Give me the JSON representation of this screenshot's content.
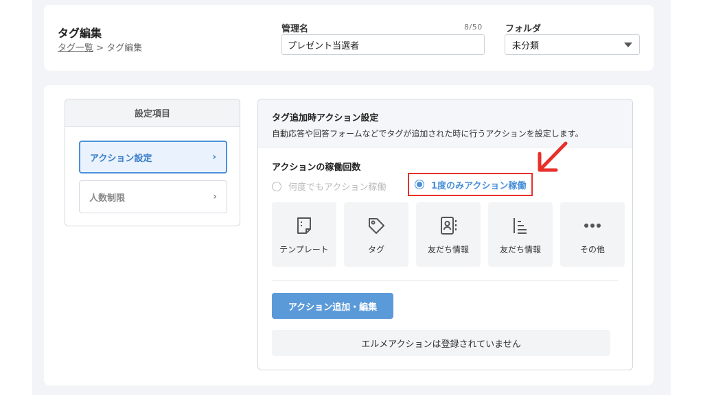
{
  "header": {
    "title": "タグ編集",
    "breadcrumb": {
      "link": "タグ一覧",
      "separator": " > ",
      "current": "タグ編集"
    },
    "name_field": {
      "label": "管理名",
      "counter": "8/50",
      "value": "プレゼント当選者"
    },
    "folder_field": {
      "label": "フォルダ",
      "value": "未分類"
    }
  },
  "side_menu": {
    "title": "設定項目",
    "items": [
      {
        "label": "アクション設定",
        "active": true
      },
      {
        "label": "人数制限",
        "active": false
      }
    ]
  },
  "settings": {
    "title": "タグ追加時アクション設定",
    "description": "自動応答や回答フォームなどでタグが追加された時に行うアクションを設定します。",
    "frequency_label": "アクションの稼働回数",
    "radio_options": [
      {
        "label": "何度でもアクション稼働",
        "selected": false
      },
      {
        "label": "1度のみアクション稼働",
        "selected": true
      }
    ],
    "tiles": [
      {
        "label": "テンプレート",
        "icon": "template-icon"
      },
      {
        "label": "タグ",
        "icon": "tag-icon"
      },
      {
        "label": "友だち情報",
        "icon": "contact-card-icon"
      },
      {
        "label": "友だち情報",
        "icon": "list-icon"
      },
      {
        "label": "その他",
        "icon": "more-icon"
      }
    ],
    "add_button_label": "アクション追加・編集",
    "empty_message": "エルメアクションは登録されていません"
  },
  "colors": {
    "accent": "#4a90d9",
    "highlight": "#e8302a",
    "button": "#5b9ad9"
  }
}
